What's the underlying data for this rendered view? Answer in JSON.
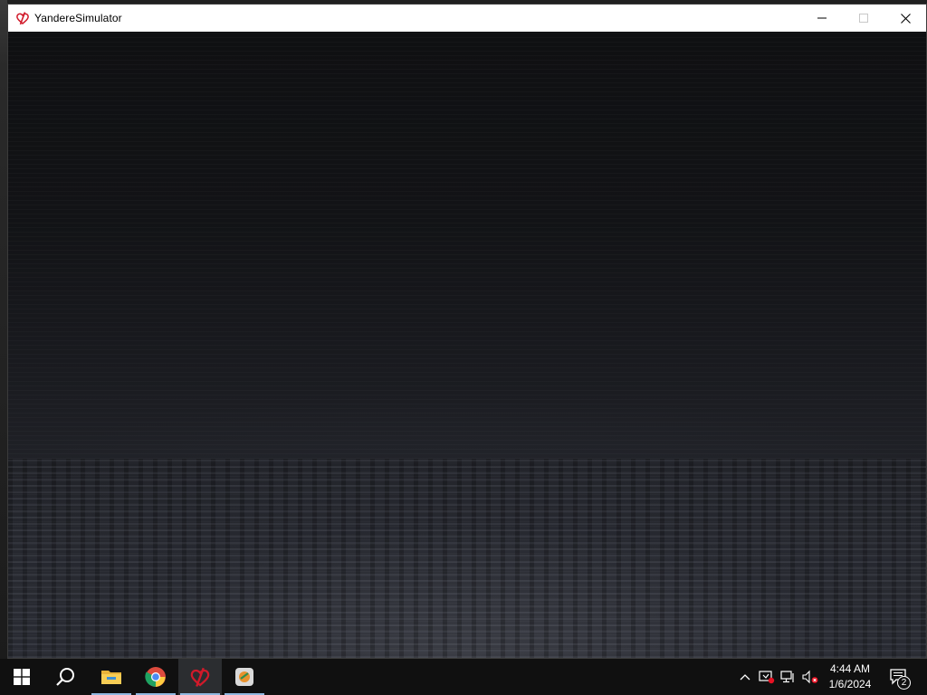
{
  "window": {
    "title": "YandereSimulator",
    "app_icon": "yandere-heart-icon"
  },
  "window_controls": {
    "minimize_icon": "minimize-icon",
    "maximize_icon": "maximize-icon",
    "close_icon": "close-icon"
  },
  "taskbar": {
    "items": [
      {
        "name": "start",
        "icon": "windows-logo-icon",
        "active": false
      },
      {
        "name": "search",
        "icon": "search-icon",
        "active": false
      },
      {
        "name": "file-explorer",
        "icon": "folder-icon",
        "active": false,
        "running": true
      },
      {
        "name": "chrome",
        "icon": "chrome-icon",
        "active": false,
        "running": true
      },
      {
        "name": "yandere-simulator",
        "icon": "yandere-heart-icon",
        "active": true,
        "running": true
      },
      {
        "name": "launcher",
        "icon": "launcher-icon",
        "active": false,
        "running": true
      }
    ],
    "tray": {
      "overflow_icon": "chevron-up-icon",
      "icons": [
        "security-warning-icon",
        "network-icon",
        "volume-muted-icon"
      ],
      "time": "4:44 AM",
      "date": "1/6/2024",
      "notification_count": "2"
    }
  },
  "colors": {
    "taskbar_bg": "#101010",
    "accent_underline": "#8fb8e0",
    "title_bar": "#ffffff",
    "game_bg": "#101113",
    "heart_red": "#d11a2a"
  }
}
